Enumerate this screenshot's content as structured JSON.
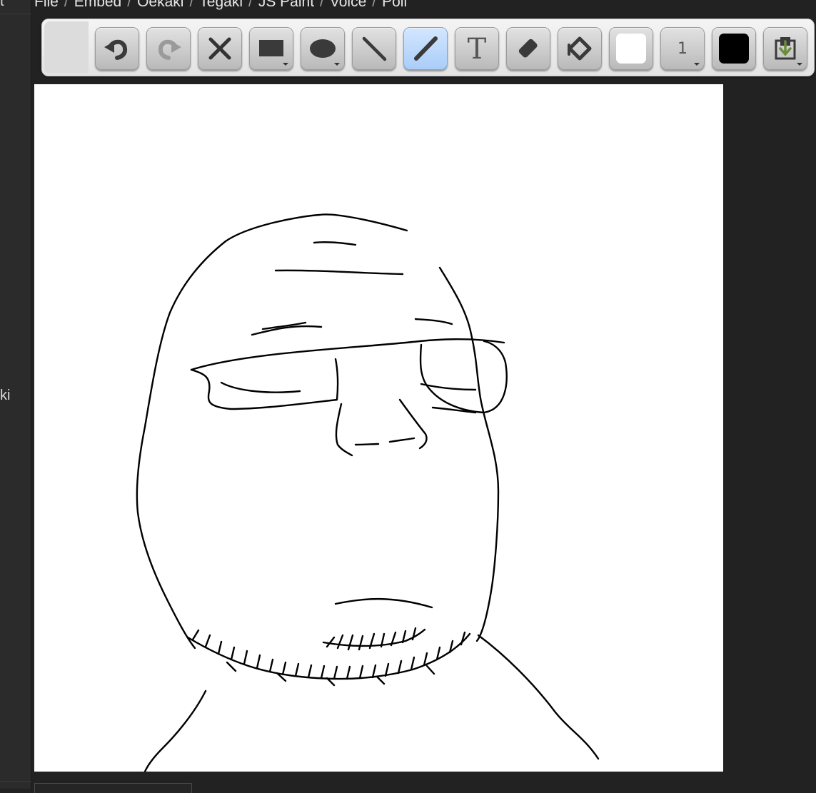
{
  "left_panel": {
    "top_text": "t",
    "middle_text": "ki"
  },
  "menu": {
    "items": [
      "File",
      "Embed",
      "Oekaki",
      "Tegaki",
      "JS Paint",
      "Voice",
      "Poll"
    ],
    "separator": "/"
  },
  "toolbar": {
    "tools": [
      {
        "name": "undo",
        "icon": "undo-icon"
      },
      {
        "name": "redo",
        "icon": "redo-icon",
        "disabled": true
      },
      {
        "name": "clear",
        "icon": "close-icon"
      },
      {
        "name": "rectangle",
        "icon": "rectangle-icon",
        "has_dropdown": true
      },
      {
        "name": "ellipse",
        "icon": "ellipse-icon",
        "has_dropdown": true
      },
      {
        "name": "line",
        "icon": "line-icon"
      },
      {
        "name": "pencil",
        "icon": "pencil-icon",
        "active": true
      },
      {
        "name": "text",
        "icon": "text-icon",
        "label": "T"
      },
      {
        "name": "eraser",
        "icon": "eraser-icon"
      },
      {
        "name": "fill",
        "icon": "fill-icon"
      }
    ],
    "fill_color": "#ffffff",
    "brush_size": "1",
    "stroke_color": "#000000",
    "save_icon": "save-icon"
  },
  "canvas": {
    "background": "#ffffff",
    "stroke": "#000000"
  },
  "colors": {
    "page_bg": "#222222",
    "active_tool": "#a9cdf8"
  }
}
